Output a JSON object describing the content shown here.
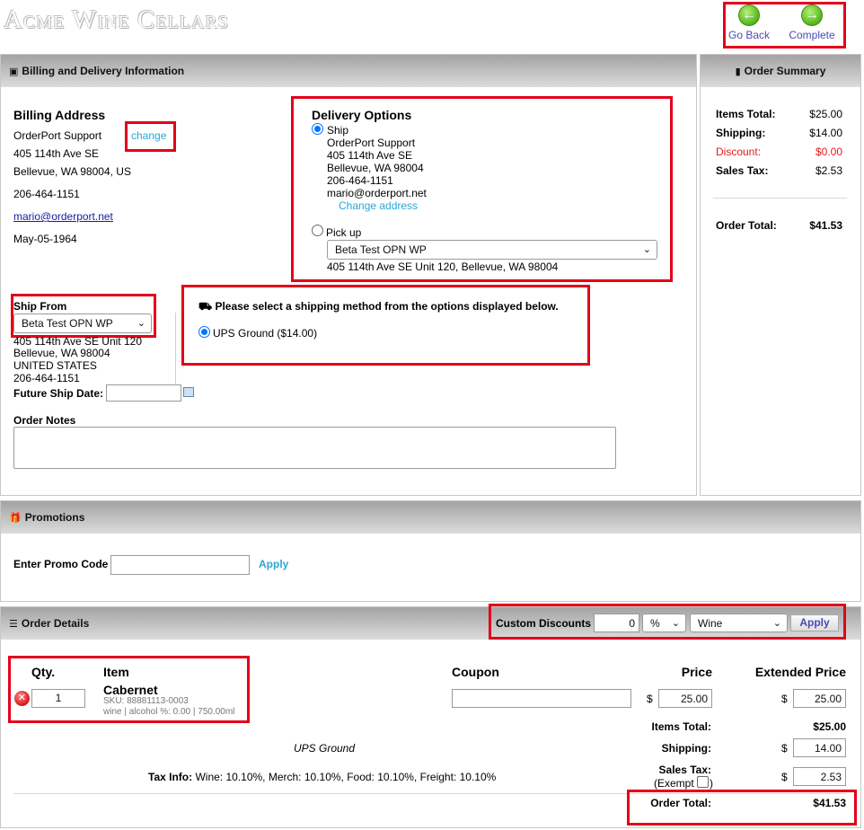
{
  "header": {
    "logo": "Acme Wine Cellars",
    "go_back": "Go Back",
    "complete": "Complete"
  },
  "billing_panel": {
    "title": "Billing and Delivery Information",
    "billing_title": "Billing Address",
    "change": "change",
    "name": "OrderPort Support",
    "street": "405 114th Ave SE",
    "city": "Bellevue, WA 98004, US",
    "phone": "206-464-1151",
    "email": "mario@orderport.net",
    "dob": "May-05-1964"
  },
  "delivery": {
    "title": "Delivery Options",
    "ship_label": "Ship",
    "ship_name": "OrderPort Support",
    "ship_street": "405 114th Ave SE",
    "ship_city": "Bellevue, WA 98004",
    "ship_phone": "206-464-1151",
    "ship_email": "mario@orderport.net",
    "change_address": "Change address",
    "pickup_label": "Pick up",
    "pickup_select": "Beta Test OPN WP",
    "pickup_address": "405 114th Ave SE Unit 120, Bellevue, WA 98004"
  },
  "ship_from": {
    "label": "Ship From",
    "select": "Beta Test OPN WP",
    "street": "405 114th Ave SE Unit 120",
    "city": "Bellevue, WA 98004",
    "country": "UNITED STATES",
    "phone": "206-464-1151",
    "future_label": "Future Ship Date:",
    "future_value": ""
  },
  "shipping_method": {
    "prompt": "Please select a shipping method from the options displayed below.",
    "option": "UPS Ground ($14.00)"
  },
  "order_notes": {
    "label": "Order Notes",
    "value": ""
  },
  "summary": {
    "title": "Order Summary",
    "items_label": "Items Total:",
    "items_value": "$25.00",
    "shipping_label": "Shipping:",
    "shipping_value": "$14.00",
    "discount_label": "Discount:",
    "discount_value": "$0.00",
    "tax_label": "Sales Tax:",
    "tax_value": "$2.53",
    "total_label": "Order Total:",
    "total_value": "$41.53"
  },
  "promotions": {
    "title": "Promotions",
    "label": "Enter Promo Code",
    "value": "",
    "apply": "Apply"
  },
  "order_details": {
    "title": "Order Details",
    "custom_discounts_label": "Custom Discounts",
    "discount_value": "0",
    "discount_unit": "%",
    "discount_category": "Wine",
    "apply": "Apply",
    "col_qty": "Qty.",
    "col_item": "Item",
    "col_coupon": "Coupon",
    "col_price": "Price",
    "col_extended": "Extended Price",
    "item": {
      "qty": "1",
      "name": "Cabernet",
      "sku": "SKU: 88881113-0003",
      "meta": "wine | alcohol %: 0.00 | 750.00ml",
      "coupon": "",
      "currency": "$",
      "price": "25.00",
      "extended": "25.00"
    },
    "items_total_label": "Items Total:",
    "items_total_value": "$25.00",
    "shipping_method": "UPS Ground",
    "shipping_label": "Shipping:",
    "shipping_value": "14.00",
    "tax_info_label": "Tax Info:",
    "tax_info_value": "Wine: 10.10%, Merch: 10.10%, Food: 10.10%, Freight: 10.10%",
    "sales_tax_label": "Sales Tax:",
    "exempt_label": "(Exempt",
    "sales_tax_value": "2.53",
    "order_total_label": "Order Total:",
    "order_total_value": "$41.53"
  }
}
